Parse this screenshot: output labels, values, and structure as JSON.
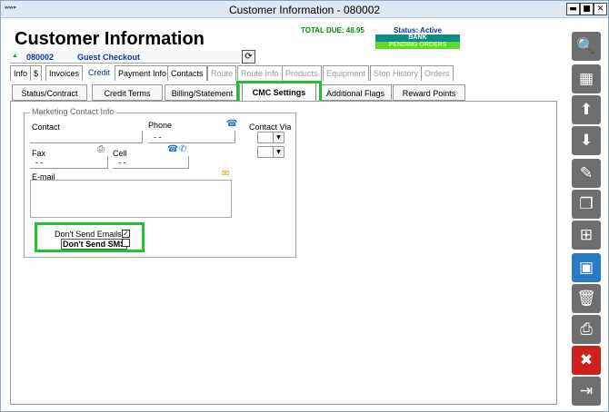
{
  "window": {
    "title": "Customer Information - 080002",
    "app_icon_text": "ᵂᵂᴾ",
    "minimize_glyph": "▬",
    "maximize_glyph": "■",
    "close_glyph": "✕"
  },
  "header": {
    "page_title": "Customer Information",
    "total_due": "TOTAL DUE:  48.95",
    "status": "Status: Active",
    "badge_bank": "BANK",
    "badge_pending": "PENDING ORDERS",
    "customer_flag": "▲",
    "customer_id": "080002",
    "customer_name": "Guest Checkout",
    "refresh_glyph": "⟳"
  },
  "main_tabs": [
    {
      "label": "Info"
    },
    {
      "label": "$"
    },
    {
      "label": "Invoices"
    },
    {
      "label": "Credit"
    },
    {
      "label": "Payment Info"
    },
    {
      "label": "Contacts"
    },
    {
      "label": "Route"
    },
    {
      "label": "Route Info"
    },
    {
      "label": "Products"
    },
    {
      "label": "Equipment"
    },
    {
      "label": "Stop History"
    },
    {
      "label": "Orders"
    }
  ],
  "sub_tabs": [
    {
      "label": "Status/Contract"
    },
    {
      "label": "Credit Terms"
    },
    {
      "label": "Billing/Statement"
    },
    {
      "label": "CMC Settings"
    },
    {
      "label": "Additional Flags"
    },
    {
      "label": "Reward Points"
    }
  ],
  "marketing": {
    "legend": "Marketing Contact Info",
    "contact_label": "Contact",
    "contact_value": "",
    "phone_label": "Phone",
    "phone_value": "-  -",
    "contact_via_label": "Contact Via",
    "fax_label": "Fax",
    "fax_value": "-  -",
    "cell_label": "Cell",
    "cell_value": "-  -",
    "email_label": "E-mail",
    "email_value": "",
    "dont_send_emails_label": "Don't Send Emails",
    "dont_send_emails_checked": "✓",
    "dont_send_sms_label": "Don't Send SMS",
    "dont_send_sms_checked": ""
  },
  "toolbar": [
    {
      "icon": "magnifier-icon",
      "glyph": "🔍"
    },
    {
      "icon": "calculator-icon",
      "glyph": "▦"
    },
    {
      "icon": "arrow-up-icon",
      "glyph": "⬆"
    },
    {
      "icon": "arrow-down-icon",
      "glyph": "⬇"
    },
    {
      "icon": "pencil-icon",
      "glyph": "✎"
    },
    {
      "icon": "copy-icon",
      "glyph": "❐"
    },
    {
      "icon": "save-new-icon",
      "glyph": "⊞"
    },
    {
      "icon": "save-icon",
      "glyph": "▣"
    },
    {
      "icon": "trash-icon",
      "glyph": "🗑"
    },
    {
      "icon": "printer-icon",
      "glyph": "⎙"
    },
    {
      "icon": "close-icon",
      "glyph": "✖"
    },
    {
      "icon": "exit-door-icon",
      "glyph": "⇥"
    }
  ],
  "colors": {
    "highlight": "#22c133",
    "link_blue": "#1133aa",
    "toolbar_gray": "#6e6e6e",
    "toolbar_blue": "#2a7bc6",
    "toolbar_red": "#cf2020"
  }
}
